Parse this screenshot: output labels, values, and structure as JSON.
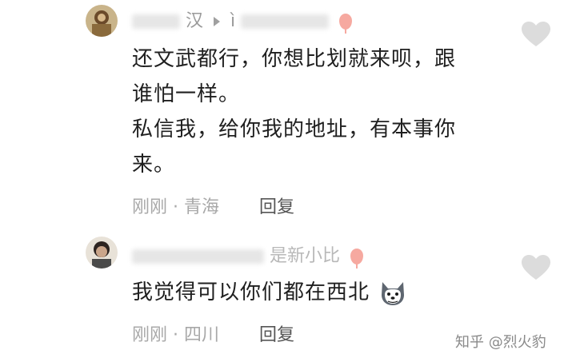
{
  "comments": [
    {
      "name_visible": "汉",
      "name_visible_2": "ì",
      "text_line1": "还文武都行，你想比划就来呗，跟",
      "text_line2": "谁怕一样。",
      "text_line3": "私信我，给你我的地址，有本事你",
      "text_line4": "来。",
      "time": "刚刚",
      "location": "青海",
      "reply_label": "回复"
    },
    {
      "name_visible": "是新小比",
      "text": "我觉得可以你们都在西北",
      "time": "刚刚",
      "location": "四川",
      "reply_label": "回复"
    }
  ],
  "separator": "·",
  "watermark": "知乎 @烈火豹",
  "colors": {
    "heart": "#dcdcdc",
    "balloon": "#f6a9a0",
    "meta": "#a8a8a8"
  },
  "icons": [
    "heart-icon",
    "balloon-icon",
    "husky-emoji-icon",
    "play-arrow-icon"
  ]
}
